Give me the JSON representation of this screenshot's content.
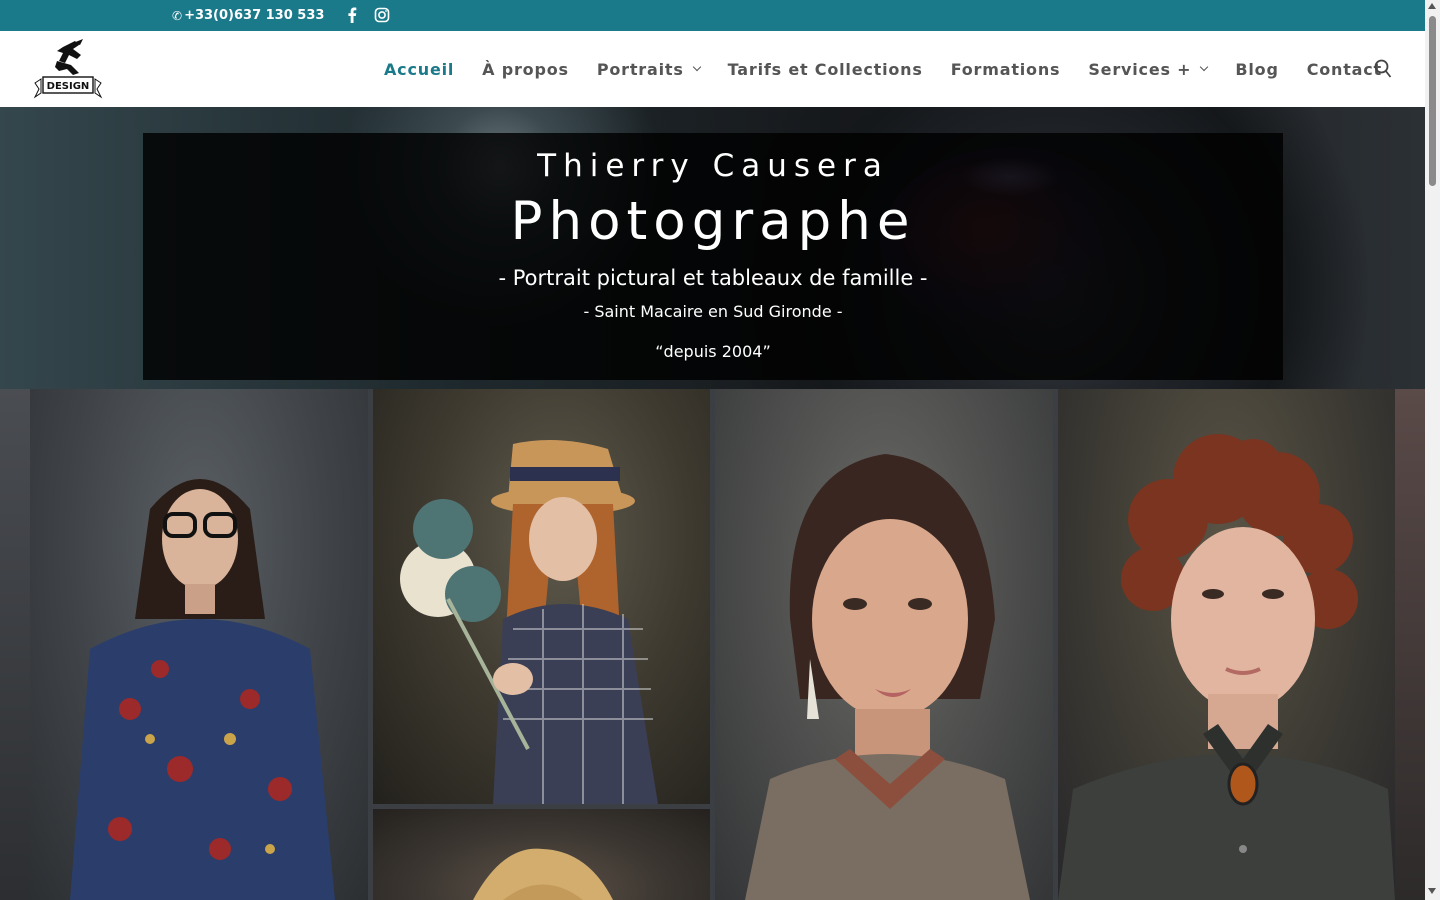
{
  "topbar": {
    "phone": "+33(0)637 130 533",
    "phone_icon": "phone-icon",
    "social": [
      {
        "name": "facebook-icon"
      },
      {
        "name": "instagram-icon"
      }
    ],
    "background": "#1b7a8a"
  },
  "header": {
    "logo_text": "DESIGN",
    "nav": [
      {
        "label": "Accueil",
        "active": true,
        "dropdown": false
      },
      {
        "label": "À propos",
        "active": false,
        "dropdown": false
      },
      {
        "label": "Portraits",
        "active": false,
        "dropdown": true
      },
      {
        "label": "Tarifs et Collections",
        "active": false,
        "dropdown": false
      },
      {
        "label": "Formations",
        "active": false,
        "dropdown": false
      },
      {
        "label": "Services +",
        "active": false,
        "dropdown": true
      },
      {
        "label": "Blog",
        "active": false,
        "dropdown": false
      },
      {
        "label": "Contact",
        "active": false,
        "dropdown": false
      }
    ],
    "search_icon": "search-icon",
    "accent": "#1b7a8a"
  },
  "hero": {
    "name": "Thierry Causera",
    "title": "Photographe",
    "subtitle": "- Portrait pictural et tableaux de famille -",
    "location": "- Saint Macaire en Sud Gironde -",
    "since": "“depuis 2004”"
  },
  "gallery": {
    "photos": [
      {
        "name": "portrait-woman-glasses"
      },
      {
        "name": "portrait-girl-hat-flowers"
      },
      {
        "name": "portrait-blonde-partial"
      },
      {
        "name": "portrait-woman-earring"
      },
      {
        "name": "portrait-curly-hair-man"
      }
    ]
  }
}
